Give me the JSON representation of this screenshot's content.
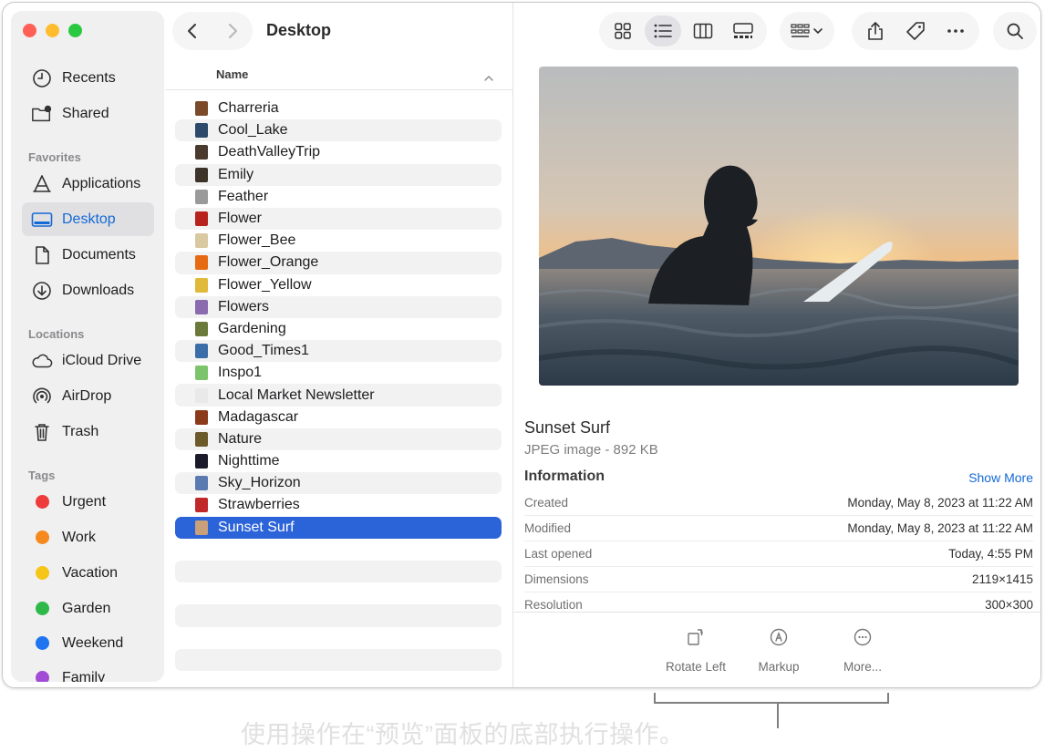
{
  "window": {
    "traffic_colors": {
      "close": "#ff5f57",
      "minimize": "#febc2e",
      "zoom": "#28c840"
    }
  },
  "sidebar": {
    "top_items": [
      {
        "label": "Recents",
        "icon": "clock-icon"
      },
      {
        "label": "Shared",
        "icon": "shared-folder-icon"
      }
    ],
    "favorites_heading": "Favorites",
    "favorites": [
      {
        "label": "Applications",
        "icon": "applications-icon"
      },
      {
        "label": "Desktop",
        "icon": "desktop-icon",
        "active": true
      },
      {
        "label": "Documents",
        "icon": "document-icon"
      },
      {
        "label": "Downloads",
        "icon": "download-icon"
      }
    ],
    "locations_heading": "Locations",
    "locations": [
      {
        "label": "iCloud Drive",
        "icon": "cloud-icon"
      },
      {
        "label": "AirDrop",
        "icon": "airdrop-icon"
      },
      {
        "label": "Trash",
        "icon": "trash-icon"
      }
    ],
    "tags_heading": "Tags",
    "tags": [
      {
        "label": "Urgent",
        "color": "#ee3b3b"
      },
      {
        "label": "Work",
        "color": "#f5891e"
      },
      {
        "label": "Vacation",
        "color": "#f5c518"
      },
      {
        "label": "Garden",
        "color": "#2fb84a"
      },
      {
        "label": "Weekend",
        "color": "#1f74f0"
      },
      {
        "label": "Family",
        "color": "#a24cd6"
      }
    ]
  },
  "list": {
    "folder_title": "Desktop",
    "column_name": "Name",
    "files": [
      {
        "name": "Charreria",
        "color": "#7a4a2a"
      },
      {
        "name": "Cool_Lake",
        "color": "#2d4a6b"
      },
      {
        "name": "DeathValleyTrip",
        "color": "#4b3a2e"
      },
      {
        "name": "Emily",
        "color": "#3d3328"
      },
      {
        "name": "Feather",
        "color": "#9a9a9a"
      },
      {
        "name": "Flower",
        "color": "#b8231e"
      },
      {
        "name": "Flower_Bee",
        "color": "#d9c9a0"
      },
      {
        "name": "Flower_Orange",
        "color": "#e66a12"
      },
      {
        "name": "Flower_Yellow",
        "color": "#e0b83a"
      },
      {
        "name": "Flowers",
        "color": "#8a6bb0"
      },
      {
        "name": "Gardening",
        "color": "#6b7a3a"
      },
      {
        "name": "Good_Times1",
        "color": "#3b6ea8"
      },
      {
        "name": "Inspo1",
        "color": "#7cc46b"
      },
      {
        "name": "Local Market Newsletter",
        "color": "#e9e9e9"
      },
      {
        "name": "Madagascar",
        "color": "#8b3a1a"
      },
      {
        "name": "Nature",
        "color": "#6b5a2a"
      },
      {
        "name": "Nighttime",
        "color": "#1a1a2a"
      },
      {
        "name": "Sky_Horizon",
        "color": "#5a7ab0"
      },
      {
        "name": "Strawberries",
        "color": "#c0282a"
      },
      {
        "name": "Sunset Surf",
        "color": "#c9a07a",
        "selected": true
      }
    ]
  },
  "preview": {
    "title": "Sunset Surf",
    "subtitle": "JPEG image - 892 KB",
    "info_heading": "Information",
    "show_more": "Show More",
    "info": [
      {
        "key": "Created",
        "value": "Monday, May 8, 2023 at 11:22 AM"
      },
      {
        "key": "Modified",
        "value": "Monday, May 8, 2023 at 11:22 AM"
      },
      {
        "key": "Last opened",
        "value": "Today, 4:55 PM"
      },
      {
        "key": "Dimensions",
        "value": "2119×1415"
      },
      {
        "key": "Resolution",
        "value": "300×300"
      }
    ],
    "actions": [
      {
        "label": "Rotate Left",
        "icon": "rotate-left-icon"
      },
      {
        "label": "Markup",
        "icon": "markup-icon"
      },
      {
        "label": "More...",
        "icon": "more-icon"
      }
    ]
  },
  "toolbar": {
    "views": [
      "icon-view-icon",
      "list-view-icon",
      "column-view-icon",
      "gallery-view-icon"
    ],
    "active_view": "list-view-icon"
  },
  "caption": "使用操作在“预览”面板的底部执行操作。"
}
